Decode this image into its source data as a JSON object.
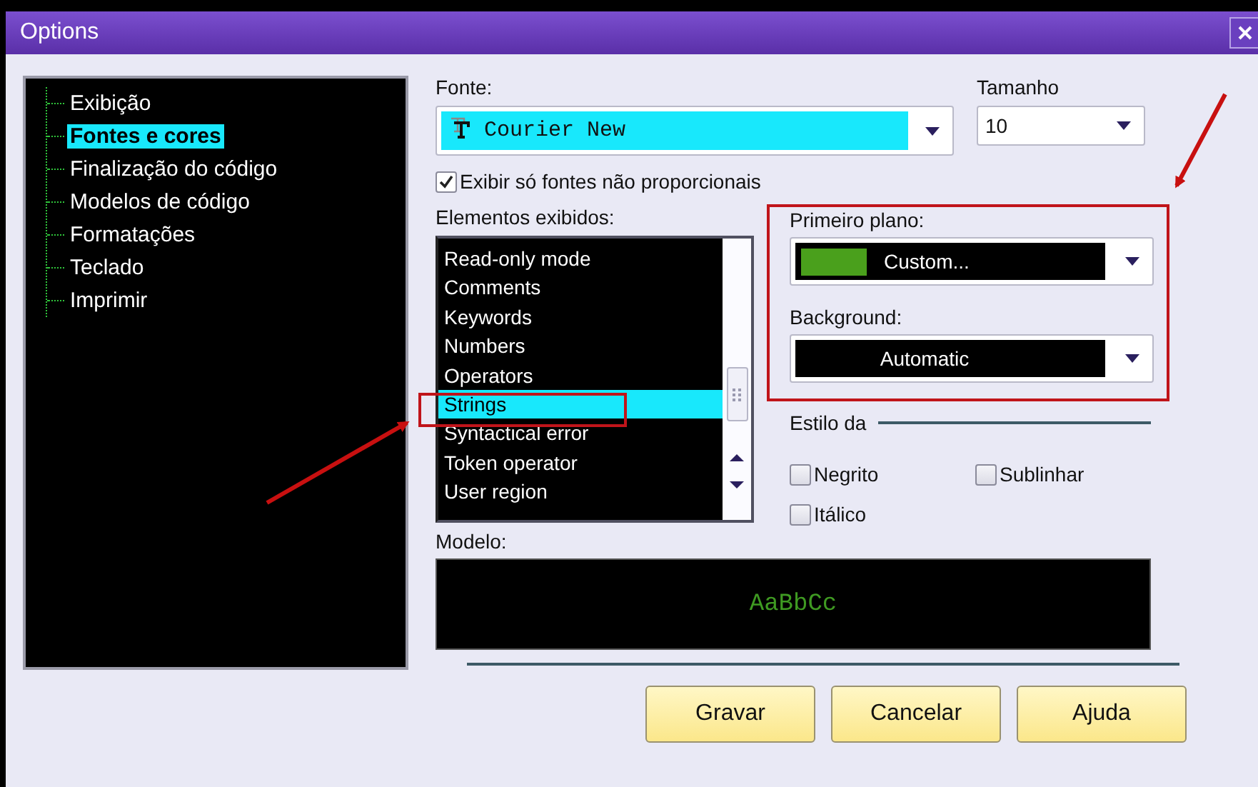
{
  "window": {
    "title": "Options"
  },
  "tree": {
    "items": [
      {
        "label": "Exibição",
        "selected": false
      },
      {
        "label": "Fontes e cores",
        "selected": true
      },
      {
        "label": "Finalização do código",
        "selected": false
      },
      {
        "label": "Modelos de código",
        "selected": false
      },
      {
        "label": "Formatações",
        "selected": false
      },
      {
        "label": "Teclado",
        "selected": false
      },
      {
        "label": "Imprimir",
        "selected": false
      }
    ]
  },
  "font": {
    "label": "Fonte:",
    "value": "Courier New"
  },
  "size": {
    "label": "Tamanho",
    "value": "10"
  },
  "monospace_only": {
    "label": "Exibir só fontes não proporcionais",
    "checked": true
  },
  "elements": {
    "label": "Elementos exibidos:",
    "items": [
      {
        "label": "Read-only mode",
        "selected": false
      },
      {
        "label": "Comments",
        "selected": false
      },
      {
        "label": "Keywords",
        "selected": false
      },
      {
        "label": "Numbers",
        "selected": false
      },
      {
        "label": "Operators",
        "selected": false
      },
      {
        "label": "Strings",
        "selected": true
      },
      {
        "label": "Syntactical error",
        "selected": false
      },
      {
        "label": "Token operator",
        "selected": false
      },
      {
        "label": "User region",
        "selected": false
      }
    ]
  },
  "foreground": {
    "label": "Primeiro plano:",
    "value": "Custom...",
    "color": "#4aa01c"
  },
  "background": {
    "label": "Background:",
    "value": "Automatic"
  },
  "style": {
    "label": "Estilo da",
    "options": [
      {
        "label": "Negrito",
        "checked": false
      },
      {
        "label": "Sublinhar",
        "checked": false
      },
      {
        "label": "Itálico",
        "checked": false
      }
    ]
  },
  "preview": {
    "label": "Modelo:",
    "sample": "AaBbCc"
  },
  "buttons": [
    {
      "label": "Gravar"
    },
    {
      "label": "Cancelar"
    },
    {
      "label": "Ajuda"
    }
  ]
}
